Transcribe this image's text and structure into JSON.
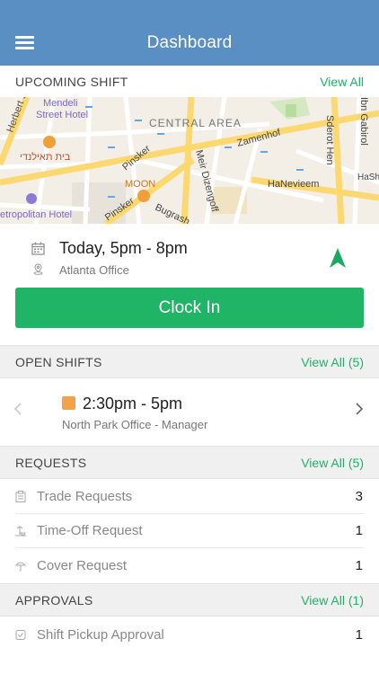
{
  "header": {
    "title": "Dashboard",
    "menu_icon": "hamburger-menu-icon"
  },
  "upcoming": {
    "section_label": "UPCOMING SHIFT",
    "view_all": "View All",
    "map_labels": {
      "mendeli": "Mendeli",
      "street_hotel": "Street Hotel",
      "herbert": "Herbert Sam",
      "central_area": "CENTRAL AREA",
      "zamenhof": "Zamenhof",
      "hebrew": "בית תאילנדי",
      "pinsker": "Pinsker",
      "moon": "MOON",
      "meir": "Meir Dizengoff",
      "sderot": "Sderot Hen",
      "gabirol": "Ibn Gabirol",
      "hanevieem": "HaNevieem",
      "metropolitan": "etropolitan Hotel",
      "pinsker2": "Pinsker",
      "bugrash": "Bugrash",
      "hash": "HaSh"
    },
    "date_text": "Today, 5pm - 8pm",
    "location": "Atlanta Office",
    "clock_in_label": "Clock In"
  },
  "open_shifts": {
    "section_label": "OPEN SHIFTS",
    "view_all": "View All (5)",
    "time": "2:30pm - 5pm",
    "detail": "North Park Office - Manager",
    "color": "#f4a24a"
  },
  "requests": {
    "section_label": "REQUESTS",
    "view_all": "View All (5)",
    "items": [
      {
        "label": "Trade Requests",
        "count": "3",
        "icon": "clipboard-icon"
      },
      {
        "label": "Time-Off Request",
        "count": "1",
        "icon": "beach-icon"
      },
      {
        "label": "Cover Request",
        "count": "1",
        "icon": "umbrella-icon"
      }
    ]
  },
  "approvals": {
    "section_label": "APPROVALS",
    "view_all": "View All (1)",
    "items": [
      {
        "label": "Shift Pickup Approval",
        "count": "1",
        "icon": "checkbox-icon"
      }
    ]
  },
  "colors": {
    "header": "#5a8fc3",
    "accent": "#1fb466",
    "link": "#1db368"
  }
}
